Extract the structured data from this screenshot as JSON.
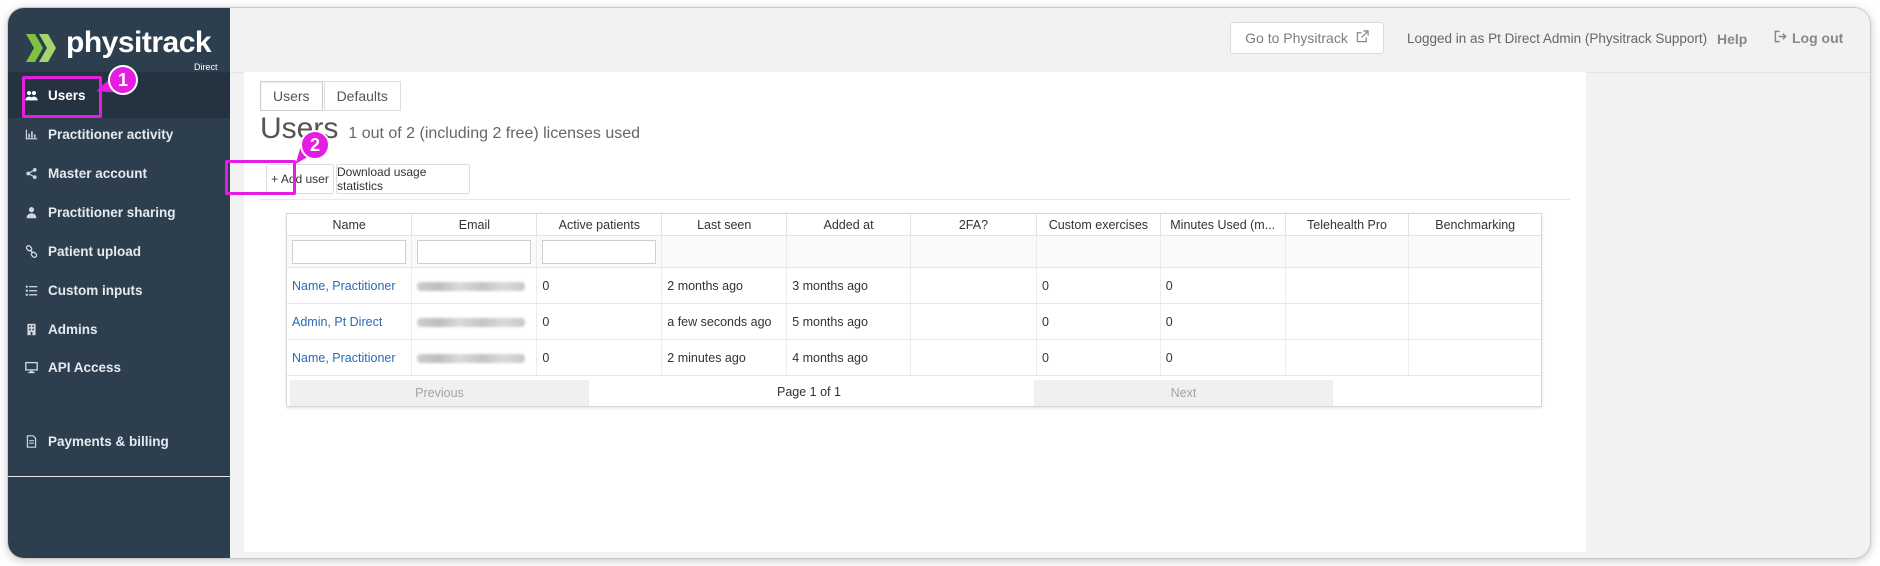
{
  "app": {
    "logo_text": "physitrack",
    "logo_sub": "Direct"
  },
  "sidebar": {
    "items": [
      {
        "label": "Users",
        "icon": "users-icon"
      },
      {
        "label": "Practitioner activity",
        "icon": "bar-chart-icon"
      },
      {
        "label": "Master account",
        "icon": "share-icon"
      },
      {
        "label": "Practitioner sharing",
        "icon": "user-icon"
      },
      {
        "label": "Patient upload",
        "icon": "link-icon"
      },
      {
        "label": "Custom inputs",
        "icon": "list-icon"
      },
      {
        "label": "Admins",
        "icon": "building-icon"
      },
      {
        "label": "API Access",
        "icon": "monitor-icon"
      }
    ],
    "footer_item": {
      "label": "Payments & billing",
      "icon": "document-icon"
    }
  },
  "header": {
    "goto_label": "Go to Physitrack",
    "logged_in_text": "Logged in as Pt Direct Admin (Physitrack Support)",
    "help_label": "Help",
    "logout_label": "Log out"
  },
  "main": {
    "tabs": [
      "Users",
      "Defaults"
    ],
    "title": "Users",
    "license_text": "1 out of 2 (including 2 free) licenses used",
    "add_user_label": "+ Add user",
    "download_label": "Download usage statistics"
  },
  "table": {
    "columns": [
      "Name",
      "Email",
      "Active patients",
      "Last seen",
      "Added at",
      "2FA?",
      "Custom exercises",
      "Minutes Used (m...",
      "Telehealth Pro",
      "Benchmarking"
    ],
    "rows": [
      {
        "name": "Name, Practitioner",
        "active": "0",
        "last_seen": "2 months ago",
        "added": "3 months ago",
        "twofa": "",
        "custom": "0",
        "minutes": "0",
        "telehealth": "",
        "bench": ""
      },
      {
        "name": "Admin, Pt Direct",
        "active": "0",
        "last_seen": "a few seconds ago",
        "added": "5 months ago",
        "twofa": "",
        "custom": "0",
        "minutes": "0",
        "telehealth": "",
        "bench": ""
      },
      {
        "name": "Name, Practitioner",
        "active": "0",
        "last_seen": "2 minutes ago",
        "added": "4 months ago",
        "twofa": "",
        "custom": "0",
        "minutes": "0",
        "telehealth": "",
        "bench": ""
      }
    ],
    "pager": {
      "previous": "Previous",
      "page_info": "Page 1 of 1",
      "next": "Next"
    }
  },
  "callouts": [
    "1",
    "2"
  ],
  "colors": {
    "sidebar_bg": "#2d3e4e",
    "highlight": "#e41ee0",
    "link": "#2a6ab5"
  }
}
